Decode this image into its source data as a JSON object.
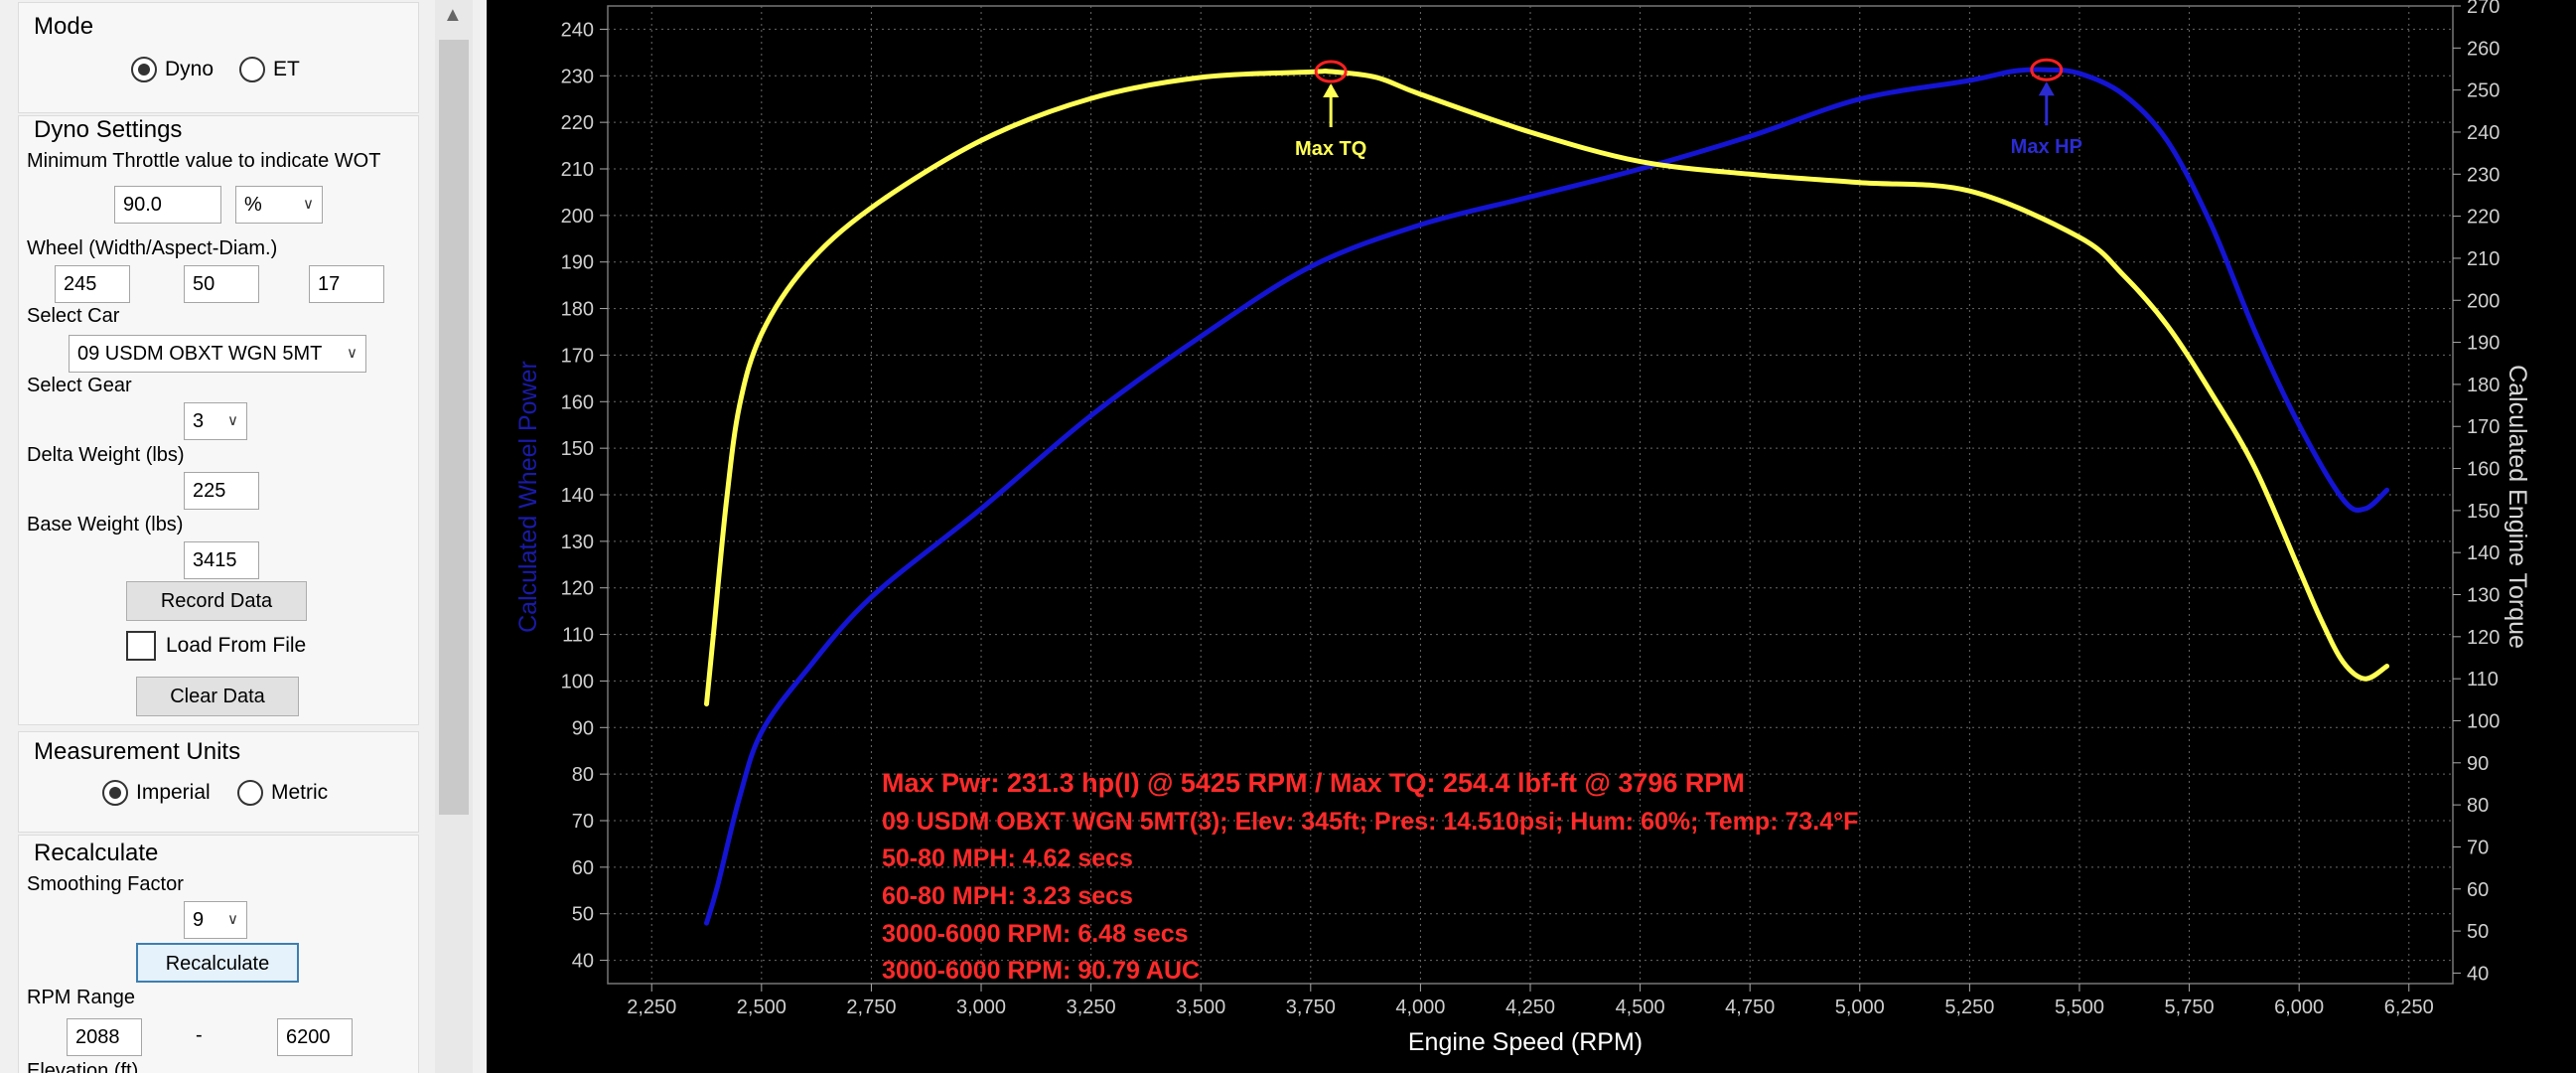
{
  "mode": {
    "title": "Mode",
    "options": [
      {
        "label": "Dyno",
        "selected": true
      },
      {
        "label": "ET",
        "selected": false
      }
    ]
  },
  "dyno_settings": {
    "title": "Dyno Settings",
    "min_throttle_label": "Minimum Throttle value to indicate WOT",
    "min_throttle_value": "90.0",
    "min_throttle_unit": "%",
    "wheel_label": "Wheel (Width/Aspect-Diam.)",
    "wheel_width": "245",
    "wheel_aspect": "50",
    "wheel_diam": "17",
    "select_car_label": "Select Car",
    "car": "09 USDM OBXT WGN 5MT",
    "select_gear_label": "Select Gear",
    "gear": "3",
    "delta_weight_label": "Delta Weight (lbs)",
    "delta_weight": "225",
    "base_weight_label": "Base Weight (lbs)",
    "base_weight": "3415",
    "record_button": "Record Data",
    "load_from_file": "Load From File",
    "clear_button": "Clear Data"
  },
  "measurement_units": {
    "title": "Measurement Units",
    "options": [
      {
        "label": "Imperial",
        "selected": true
      },
      {
        "label": "Metric",
        "selected": false
      }
    ]
  },
  "recalculate": {
    "title": "Recalculate",
    "smoothing_label": "Smoothing Factor",
    "smoothing": "9",
    "button": "Recalculate",
    "rpm_range_label": "RPM Range",
    "rpm_min": "2088",
    "rpm_sep": "-",
    "rpm_max": "6200",
    "elevation_label": "Elevation (ft)"
  },
  "chart_data": {
    "type": "line",
    "xlabel": "Engine Speed (RPM)",
    "ylabel_left": "Calculated Wheel Power",
    "ylabel_right": "Calculated Engine Torque",
    "xlim": [
      2150,
      6350
    ],
    "xticks": [
      2250,
      2500,
      2750,
      3000,
      3250,
      3500,
      3750,
      4000,
      4250,
      4500,
      4750,
      5000,
      5250,
      5500,
      5750,
      6000,
      6250
    ],
    "xtick_labels": [
      "2,250",
      "2,500",
      "2,750",
      "3,000",
      "3,250",
      "3,500",
      "3,750",
      "4,000",
      "4,250",
      "4,500",
      "4,750",
      "5,000",
      "5,250",
      "5,500",
      "5,750",
      "6,000",
      "6,250"
    ],
    "ylim_left": [
      35,
      245
    ],
    "yticks_left": [
      40,
      50,
      60,
      70,
      80,
      90,
      100,
      110,
      120,
      130,
      140,
      150,
      160,
      170,
      180,
      190,
      200,
      210,
      220,
      230,
      240
    ],
    "ylim_right": [
      37.5,
      270
    ],
    "yticks_right": [
      40,
      50,
      60,
      70,
      80,
      90,
      100,
      110,
      120,
      130,
      140,
      150,
      160,
      170,
      180,
      190,
      200,
      210,
      220,
      230,
      240,
      250,
      260,
      270
    ],
    "grid": true,
    "series": [
      {
        "axis": "left",
        "color": "#1414d2",
        "x": [
          2375,
          2400,
          2450,
          2500,
          2600,
          2750,
          3000,
          3250,
          3500,
          3750,
          4000,
          4250,
          4500,
          4750,
          5000,
          5250,
          5350,
          5425,
          5500,
          5600,
          5700,
          5800,
          5900,
          6000,
          6100,
          6150,
          6200
        ],
        "y": [
          48,
          56,
          75,
          89,
          102,
          118,
          137,
          157,
          174,
          189,
          198,
          204,
          210,
          217,
          225,
          229,
          231,
          231.3,
          230.5,
          226,
          216,
          198,
          175,
          155,
          139,
          137,
          141
        ]
      },
      {
        "axis": "right",
        "color": "#ffff55",
        "x": [
          2375,
          2390,
          2420,
          2450,
          2500,
          2600,
          2750,
          3000,
          3250,
          3500,
          3750,
          3796,
          3900,
          4000,
          4250,
          4500,
          4750,
          5000,
          5250,
          5500,
          5600,
          5700,
          5800,
          5900,
          6000,
          6050,
          6100,
          6150,
          6200
        ],
        "y": [
          104,
          120,
          152,
          175,
          192,
          208,
          222,
          238,
          248,
          253,
          254.3,
          254.4,
          253,
          249,
          240,
          233,
          230,
          228,
          226,
          215,
          206,
          194,
          178,
          160,
          136,
          124,
          114,
          110,
          113
        ]
      }
    ],
    "markers": [
      {
        "label": "Max TQ",
        "x": 3796,
        "y": 254.4,
        "axis": "right",
        "color": "#ffff55",
        "label_position": "below"
      },
      {
        "label": "Max HP",
        "x": 5425,
        "y": 231.3,
        "axis": "left",
        "color": "#2b2bd2",
        "label_position": "below"
      }
    ],
    "annotations": [
      "Max Pwr: 231.3 hp(I) @ 5425 RPM / Max TQ: 254.4 lbf-ft @ 3796 RPM",
      "09 USDM OBXT WGN 5MT(3); Elev: 345ft; Pres: 14.510psi; Hum: 60%; Temp: 73.4°F",
      "50-80 MPH: 4.62 secs",
      "60-80 MPH: 3.23 secs",
      "3000-6000 RPM: 6.48 secs",
      "3000-6000 RPM: 90.79 AUC"
    ]
  }
}
